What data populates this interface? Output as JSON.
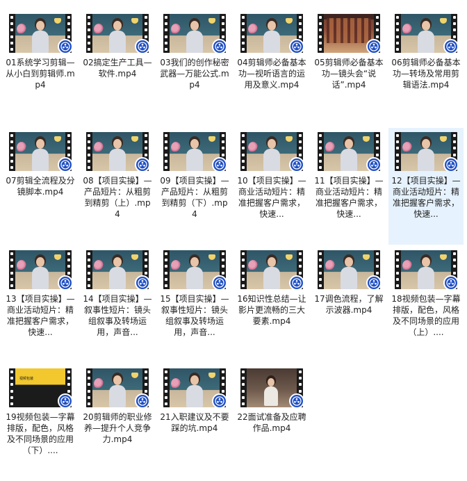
{
  "colors": {
    "selection_bg": "#e6f2fd",
    "badge_blue": "#1f4fc4",
    "text": "#222222"
  },
  "badge_icon": "video-player-app-icon",
  "files": [
    {
      "name": "01系统学习剪辑—从小白到剪辑师.mp4",
      "thumb": "room"
    },
    {
      "name": "02搞定生产工具—软件.mp4",
      "thumb": "room"
    },
    {
      "name": "03我们的创作秘密武器—万能公式.mp4",
      "thumb": "room"
    },
    {
      "name": "04剪辑师必备基本功—视听语言的运用及意义.mp4",
      "thumb": "room"
    },
    {
      "name": "05剪辑师必备基本功—镜头会“说话”.mp4",
      "thumb": "hall"
    },
    {
      "name": "06剪辑师必备基本功—转场及常用剪辑语法.mp4",
      "thumb": "room"
    },
    {
      "name": "07剪辑全流程及分镜脚本.mp4",
      "thumb": "room"
    },
    {
      "name": "08【项目实操】—产品短片：从粗剪到精剪（上）.mp4",
      "thumb": "room"
    },
    {
      "name": "09【项目实操】—产品短片：从粗剪到精剪（下）.mp4",
      "thumb": "room"
    },
    {
      "name": "10【项目实操】—商业活动短片：精准把握客户需求，快速...",
      "thumb": "room"
    },
    {
      "name": "11【项目实操】—商业活动短片：精准把握客户需求，快速...",
      "thumb": "room"
    },
    {
      "name": "12【项目实操】—商业活动短片：精准把握客户需求，快速...",
      "thumb": "room",
      "selected": true
    },
    {
      "name": "13【项目实操】—商业活动短片：精准把握客户需求，快速...",
      "thumb": "room"
    },
    {
      "name": "14【项目实操】—叙事性短片：镜头组叙事及转场运用，声音...",
      "thumb": "room"
    },
    {
      "name": "15【项目实操】—叙事性短片：镜头组叙事及转场运用，声音...",
      "thumb": "room"
    },
    {
      "name": "16知识性总结—让影片更流畅的三大要素.mp4",
      "thumb": "room"
    },
    {
      "name": "17调色流程，了解示波器.mp4",
      "thumb": "room"
    },
    {
      "name": "18视频包装—字幕排版，配色，风格及不同场景的应用（上）....",
      "thumb": "room"
    },
    {
      "name": "19视频包装—字幕排版，配色，风格及不同场景的应用（下）....",
      "thumb": "yellow",
      "thumb_text": "视频包装"
    },
    {
      "name": "20剪辑师的职业修养—提升个人竞争力.mp4",
      "thumb": "room"
    },
    {
      "name": "21入职建议及不要踩的坑.mp4",
      "thumb": "room"
    },
    {
      "name": "22面试准备及应聘作品.mp4",
      "thumb": "stage"
    }
  ]
}
